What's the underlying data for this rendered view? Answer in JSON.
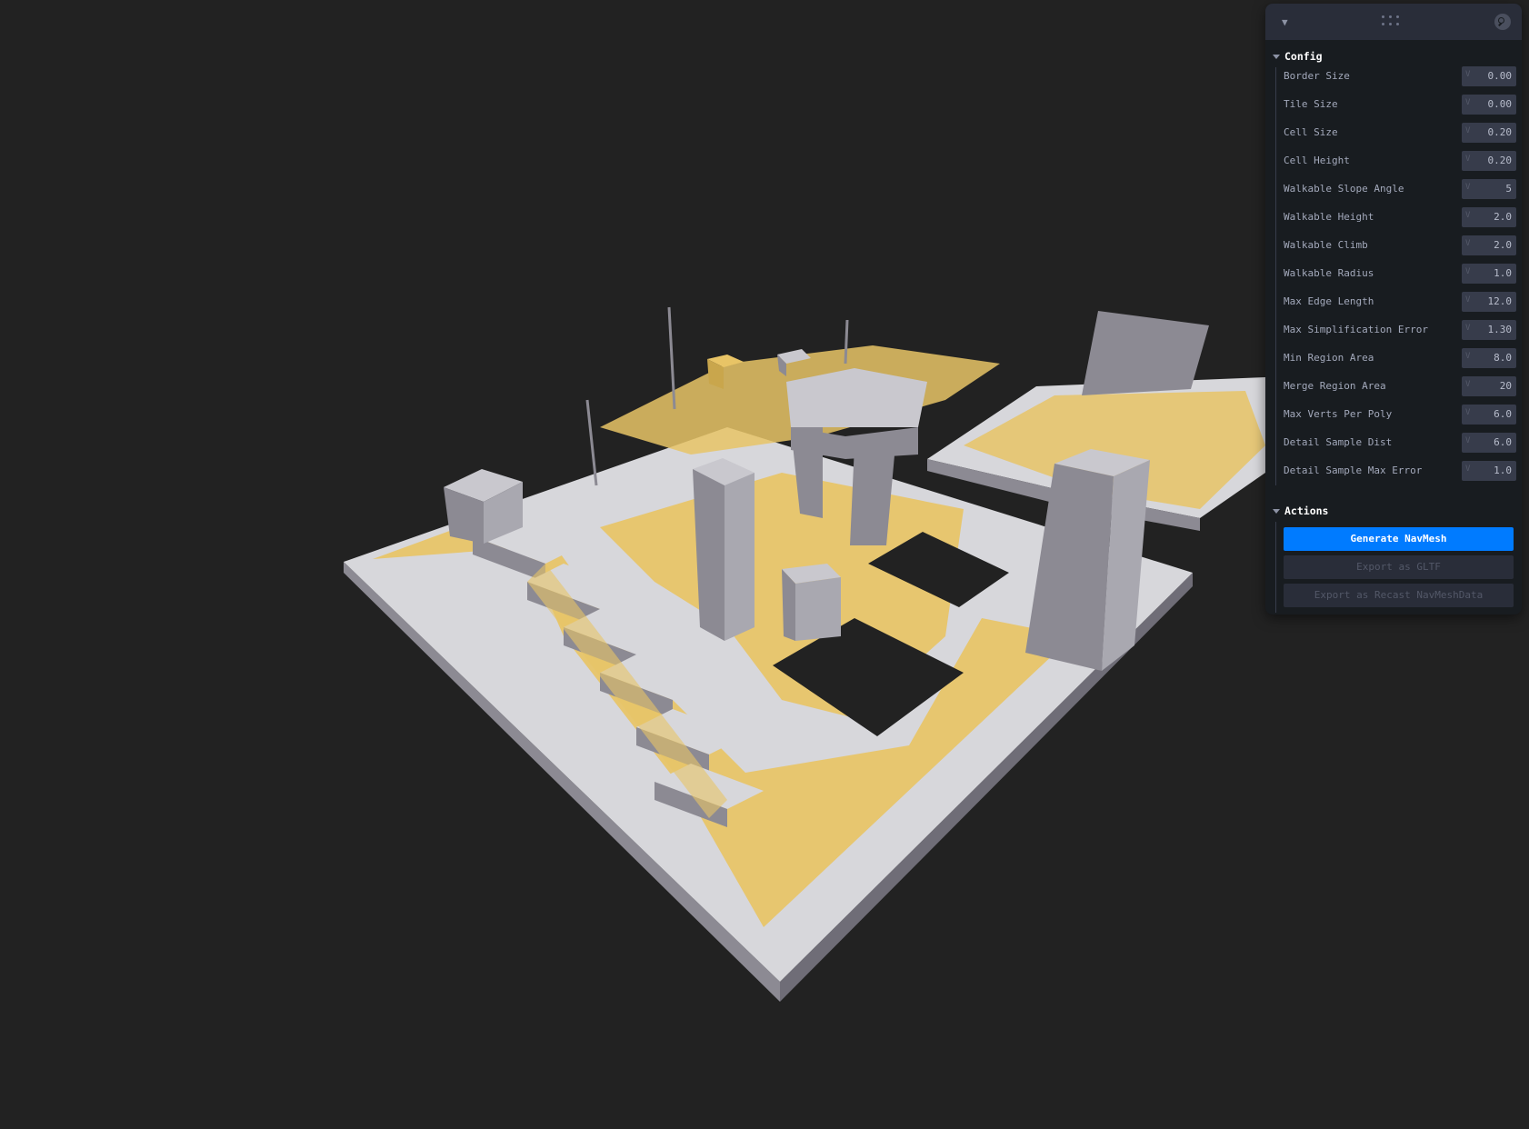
{
  "panel": {
    "config": {
      "title": "Config",
      "fields": [
        {
          "label": "Border Size",
          "value": "0.00"
        },
        {
          "label": "Tile Size",
          "value": "0.00"
        },
        {
          "label": "Cell Size",
          "value": "0.20"
        },
        {
          "label": "Cell Height",
          "value": "0.20"
        },
        {
          "label": "Walkable Slope Angle",
          "value": "5"
        },
        {
          "label": "Walkable Height",
          "value": "2.0"
        },
        {
          "label": "Walkable Climb",
          "value": "2.0"
        },
        {
          "label": "Walkable Radius",
          "value": "1.0"
        },
        {
          "label": "Max Edge Length",
          "value": "12.0"
        },
        {
          "label": "Max Simplification Error",
          "value": "1.30"
        },
        {
          "label": "Min Region Area",
          "value": "8.0"
        },
        {
          "label": "Merge Region Area",
          "value": "20"
        },
        {
          "label": "Max Verts Per Poly",
          "value": "6.0"
        },
        {
          "label": "Detail Sample Dist",
          "value": "6.0"
        },
        {
          "label": "Detail Sample Max Error",
          "value": "1.0"
        }
      ]
    },
    "actions": {
      "title": "Actions",
      "generate_label": "Generate NavMesh",
      "export_gltf_label": "Export as GLTF",
      "export_recast_label": "Export as Recast NavMeshData"
    }
  },
  "colors": {
    "background": "#222222",
    "navmesh": "#e8c466",
    "level_top": "#d7d7db",
    "level_side": "#8c8a93",
    "accent": "#007bff"
  }
}
